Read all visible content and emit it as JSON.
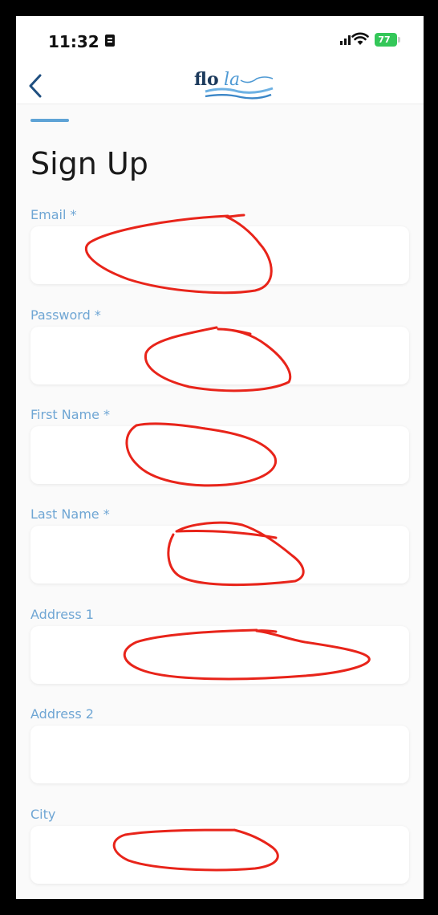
{
  "status_bar": {
    "time": "11:32",
    "battery": "77"
  },
  "colors": {
    "accent": "#5ea3d6",
    "label": "#6fa6d4",
    "annotation": "#e8241a",
    "battery": "#34c759"
  },
  "header": {
    "logo_text": "flola",
    "back_icon": "chevron-left-icon"
  },
  "page": {
    "title": "Sign Up"
  },
  "form": {
    "fields": [
      {
        "label": "Email *",
        "value": ""
      },
      {
        "label": "Password *",
        "value": ""
      },
      {
        "label": "First Name *",
        "value": ""
      },
      {
        "label": "Last Name *",
        "value": ""
      },
      {
        "label": "Address 1",
        "value": ""
      },
      {
        "label": "Address 2",
        "value": ""
      },
      {
        "label": "City",
        "value": ""
      }
    ]
  }
}
